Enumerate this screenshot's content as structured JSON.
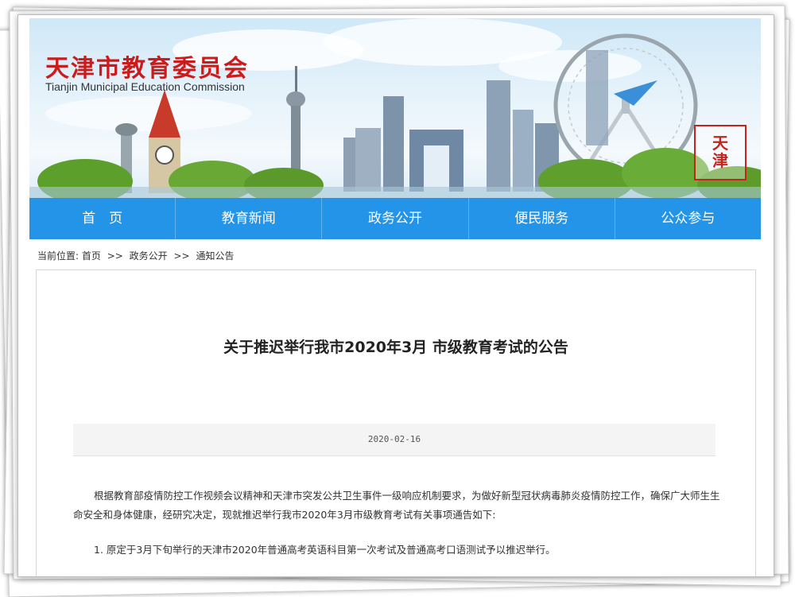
{
  "site": {
    "title": "天津市教育委员会",
    "subtitle": "Tianjin Municipal Education Commission",
    "seal_text": "天津"
  },
  "nav": {
    "items": [
      "首　页",
      "教育新闻",
      "政务公开",
      "便民服务",
      "公众参与"
    ]
  },
  "breadcrumb": {
    "label": "当前位置:",
    "items": [
      "首页",
      "政务公开",
      "通知公告"
    ],
    "separator": ">>"
  },
  "article": {
    "title": "关于推迟举行我市2020年3月 市级教育考试的公告",
    "date": "2020-02-16",
    "paragraphs": [
      "根据教育部疫情防控工作视频会议精神和天津市突发公共卫生事件一级响应机制要求，为做好新型冠状病毒肺炎疫情防控工作，确保广大师生生命安全和身体健康，经研究决定，现就推迟举行我市2020年3月市级教育考试有关事项通告如下:",
      "1. 原定于3月下旬举行的天津市2020年普通高考英语科目第一次考试及普通高考口语测试予以推迟举行。"
    ]
  },
  "colors": {
    "nav_bg": "#2494e8",
    "title_red": "#cc1b1b",
    "seal_red": "#c5231c"
  }
}
